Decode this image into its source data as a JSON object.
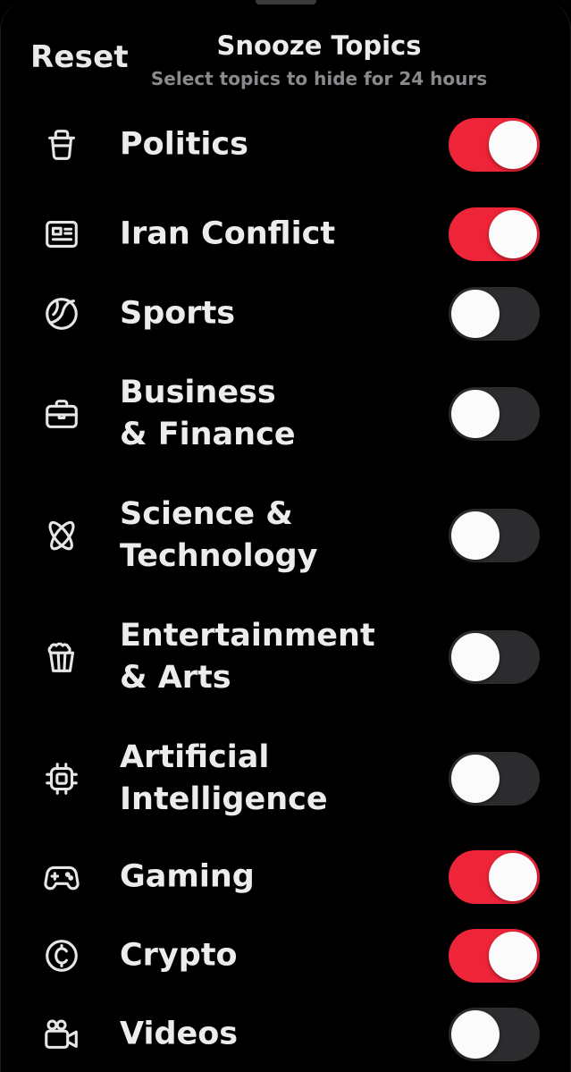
{
  "header": {
    "reset_label": "Reset",
    "title": "Snooze Topics",
    "subtitle": "Select topics to hide for 24 hours"
  },
  "colors": {
    "toggle_on": "#ee2438",
    "toggle_off": "#2c2c2e",
    "background": "#000000"
  },
  "topics": [
    {
      "lines": [
        "Politics"
      ],
      "icon": "podium-icon",
      "enabled": true
    },
    {
      "lines": [
        "Iran Conflict"
      ],
      "icon": "news-icon",
      "enabled": true
    },
    {
      "lines": [
        "Sports"
      ],
      "icon": "ball-icon",
      "enabled": false
    },
    {
      "lines": [
        "Business",
        "& Finance"
      ],
      "icon": "briefcase-icon",
      "enabled": false
    },
    {
      "lines": [
        "Science &",
        "Technology"
      ],
      "icon": "atom-icon",
      "enabled": false
    },
    {
      "lines": [
        "Entertainment",
        "& Arts"
      ],
      "icon": "popcorn-icon",
      "enabled": false
    },
    {
      "lines": [
        "Artificial",
        "Intelligence"
      ],
      "icon": "chip-icon",
      "enabled": false
    },
    {
      "lines": [
        "Gaming"
      ],
      "icon": "gamepad-icon",
      "enabled": true
    },
    {
      "lines": [
        "Crypto"
      ],
      "icon": "crypto-coin-icon",
      "enabled": true
    },
    {
      "lines": [
        "Videos"
      ],
      "icon": "video-camera-icon",
      "enabled": false
    }
  ]
}
